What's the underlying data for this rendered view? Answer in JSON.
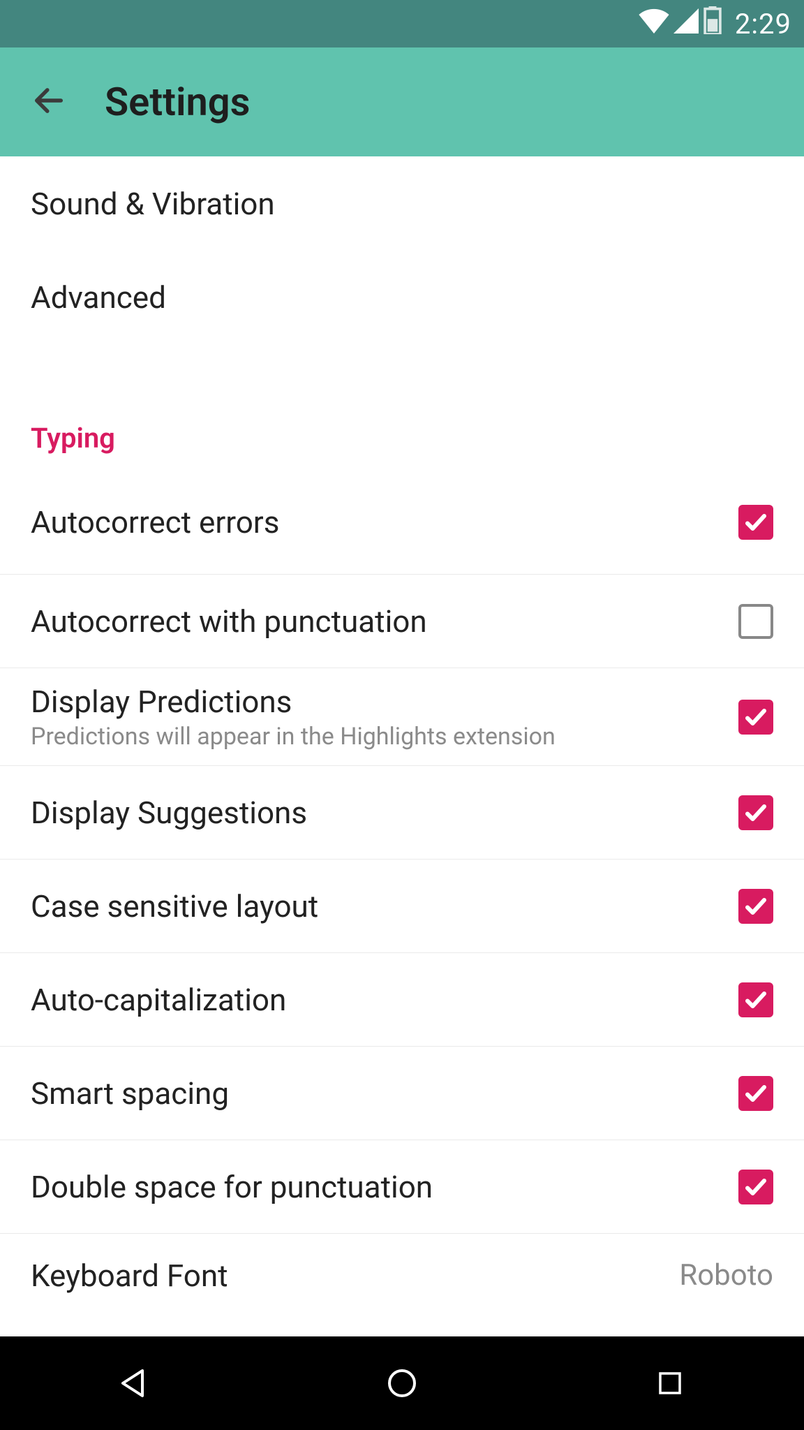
{
  "status": {
    "time": "2:29"
  },
  "header": {
    "title": "Settings"
  },
  "top_rows": [
    {
      "label": "Sound & Vibration"
    },
    {
      "label": "Advanced"
    }
  ],
  "section": {
    "typing_label": "Typing"
  },
  "typing_rows": [
    {
      "label": "Autocorrect errors",
      "checked": true
    },
    {
      "label": "Autocorrect with punctuation",
      "checked": false
    },
    {
      "label": "Display Predictions",
      "sub": "Predictions will appear in the Highlights extension",
      "checked": true
    },
    {
      "label": "Display Suggestions",
      "checked": true
    },
    {
      "label": "Case sensitive layout",
      "checked": true
    },
    {
      "label": "Auto-capitalization",
      "checked": true
    },
    {
      "label": "Smart spacing",
      "checked": true
    },
    {
      "label": "Double space for punctuation",
      "checked": true
    }
  ],
  "font_row": {
    "label": "Keyboard Font",
    "value": "Roboto"
  },
  "colors": {
    "accent": "#d81b60",
    "appbar": "#60c3ae",
    "statusbar": "#43867f"
  }
}
